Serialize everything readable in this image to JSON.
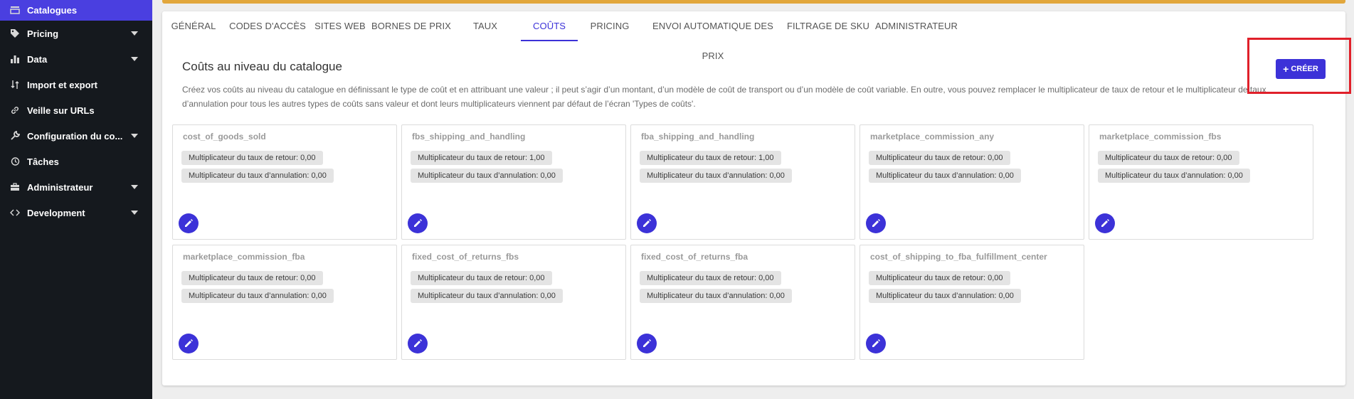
{
  "sidebar": {
    "items": [
      {
        "label": "Catalogues",
        "icon": "catalog-icon",
        "active": true,
        "expandable": false
      },
      {
        "label": "Pricing",
        "icon": "tag-icon",
        "active": false,
        "expandable": true
      },
      {
        "label": "Data",
        "icon": "bar-chart-icon",
        "active": false,
        "expandable": true
      },
      {
        "label": "Import et export",
        "icon": "import-export-icon",
        "active": false,
        "expandable": false
      },
      {
        "label": "Veille sur URLs",
        "icon": "link-icon",
        "active": false,
        "expandable": false
      },
      {
        "label": "Configuration du co...",
        "icon": "wrench-icon",
        "active": false,
        "expandable": true
      },
      {
        "label": "Tâches",
        "icon": "history-icon",
        "active": false,
        "expandable": false
      },
      {
        "label": "Administrateur",
        "icon": "toolbox-icon",
        "active": false,
        "expandable": true
      },
      {
        "label": "Development",
        "icon": "code-icon",
        "active": false,
        "expandable": true
      }
    ]
  },
  "tabs": [
    {
      "label": "GÉNÉRAL"
    },
    {
      "label": "CODES D'ACCÈS"
    },
    {
      "label": "SITES WEB"
    },
    {
      "label": "BORNES DE PRIX"
    },
    {
      "label": "TAUX"
    },
    {
      "label": "COÛTS"
    },
    {
      "label": "PRICING"
    },
    {
      "label": "ENVOI AUTOMATIQUE DES PRIX"
    },
    {
      "label": "FILTRAGE DE SKU"
    },
    {
      "label": "ADMINISTRATEUR"
    }
  ],
  "active_tab": "COÛTS",
  "section": {
    "title": "Coûts au niveau du catalogue",
    "description": "Créez vos coûts au niveau du catalogue en définissant le type de coût et en attribuant une valeur ; il peut s’agir d’un montant, d’un modèle de coût de transport ou d’un modèle de coût variable. En outre, vous pouvez remplacer le multiplicateur de taux de retour et le multiplicateur de taux d’annulation pour tous les autres types de coûts sans valeur et dont leurs multiplicateurs viennent par défaut de l’écran 'Types de coûts'."
  },
  "create_button": {
    "label": "CRÉER",
    "icon": "plus-icon"
  },
  "cost_cards": [
    {
      "name": "cost_of_goods_sold",
      "return_label": "Multiplicateur du taux de retour: 0,00",
      "cancel_label": "Multiplicateur du taux d’annulation: 0,00"
    },
    {
      "name": "fbs_shipping_and_handling",
      "return_label": "Multiplicateur du taux de retour: 1,00",
      "cancel_label": "Multiplicateur du taux d’annulation: 0,00"
    },
    {
      "name": "fba_shipping_and_handling",
      "return_label": "Multiplicateur du taux de retour: 1,00",
      "cancel_label": "Multiplicateur du taux d’annulation: 0,00"
    },
    {
      "name": "marketplace_commission_any",
      "return_label": "Multiplicateur du taux de retour: 0,00",
      "cancel_label": "Multiplicateur du taux d’annulation: 0,00"
    },
    {
      "name": "marketplace_commission_fbs",
      "return_label": "Multiplicateur du taux de retour: 0,00",
      "cancel_label": "Multiplicateur du taux d’annulation: 0,00"
    },
    {
      "name": "marketplace_commission_fba",
      "return_label": "Multiplicateur du taux de retour: 0,00",
      "cancel_label": "Multiplicateur du taux d’annulation: 0,00"
    },
    {
      "name": "fixed_cost_of_returns_fbs",
      "return_label": "Multiplicateur du taux de retour: 0,00",
      "cancel_label": "Multiplicateur du taux d’annulation: 0,00"
    },
    {
      "name": "fixed_cost_of_returns_fba",
      "return_label": "Multiplicateur du taux de retour: 0,00",
      "cancel_label": "Multiplicateur du taux d’annulation: 0,00"
    },
    {
      "name": "cost_of_shipping_to_fba_fulfillment_center",
      "return_label": "Multiplicateur du taux de retour: 0,00",
      "cancel_label": "Multiplicateur du taux d’annulation: 0,00"
    }
  ],
  "colors": {
    "accent": "#3c32d8",
    "sidebar_bg": "#15191e",
    "sidebar_active": "#4a3fe0",
    "top_strip": "#e2a73c",
    "highlight": "#e0202a"
  }
}
